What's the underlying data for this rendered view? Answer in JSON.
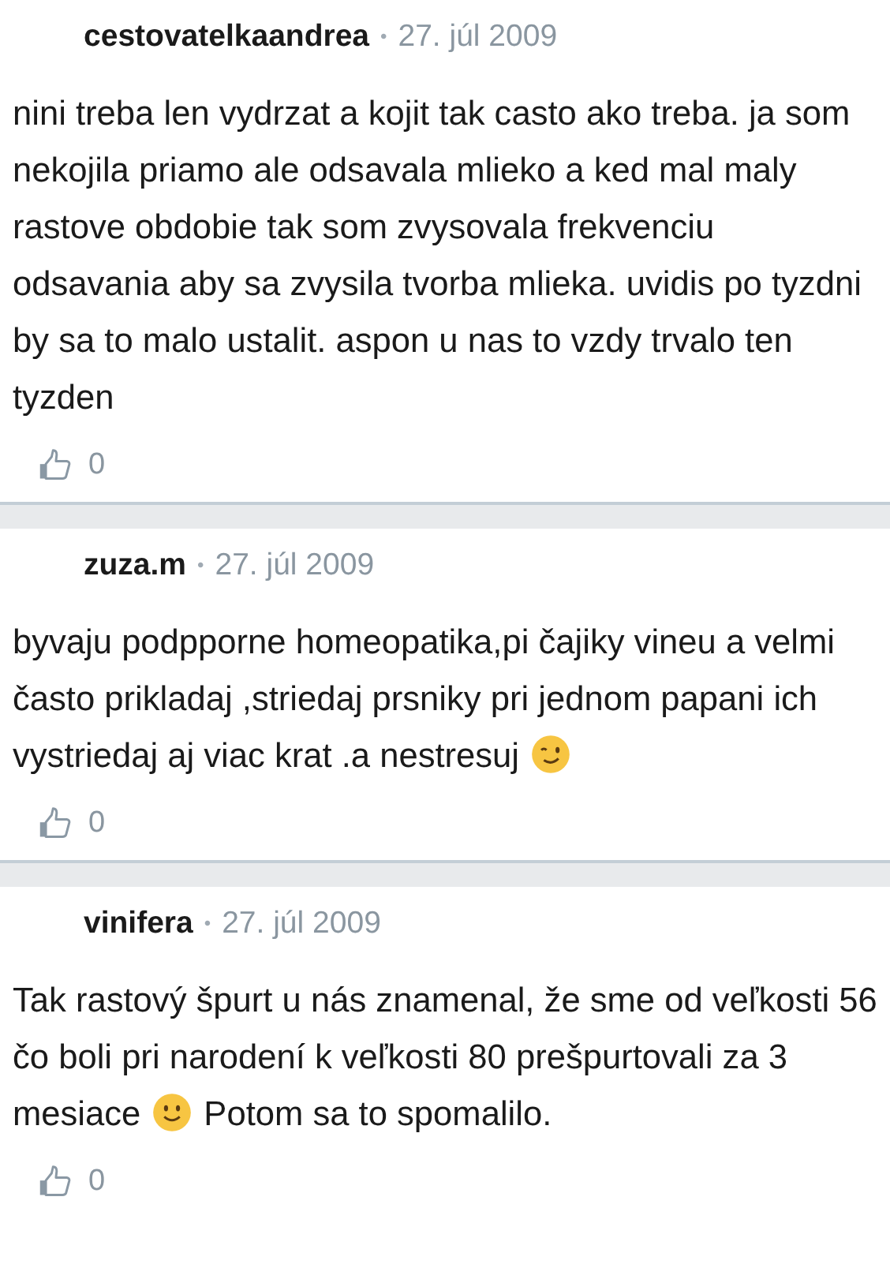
{
  "comments": [
    {
      "author": "cestovatelkaandrea",
      "separator": "•",
      "date": "27. júl 2009",
      "body": [
        {
          "kind": "text",
          "text": "nini treba len vydrzat a kojit tak casto ako treba. ja som nekojila priamo ale odsavala mlieko a ked mal maly rastove obdobie tak som zvysovala frekvenciu odsavania aby sa zvysila tvorba mlieka. uvidis po tyzdni by sa to malo ustalit. aspon u nas to vzdy trvalo ten tyzden"
        }
      ],
      "likes": "0"
    },
    {
      "author": "zuza.m",
      "separator": "•",
      "date": "27. júl 2009",
      "body": [
        {
          "kind": "text",
          "text": "byvaju podpporne homeopatika,pi čajiky vineu a velmi často prikladaj ,striedaj prsniky pri jednom papani ich"
        },
        {
          "kind": "text",
          "text": "vystriedaj aj viac krat .a nestresuj"
        },
        {
          "kind": "wink"
        }
      ],
      "likes": "0"
    },
    {
      "author": "vinifera",
      "separator": "•",
      "date": "27. júl 2009",
      "body": [
        {
          "kind": "text",
          "text": "Tak rastový špurt u nás znamenal, že sme od veľkosti 56 čo boli pri narodení k veľkosti 80 prešpurtovali za 3"
        },
        {
          "kind": "text",
          "text": "mesiace"
        },
        {
          "kind": "smile"
        },
        {
          "kind": "text",
          "text": "Potom sa to spomalilo."
        }
      ],
      "likes": "0"
    }
  ]
}
